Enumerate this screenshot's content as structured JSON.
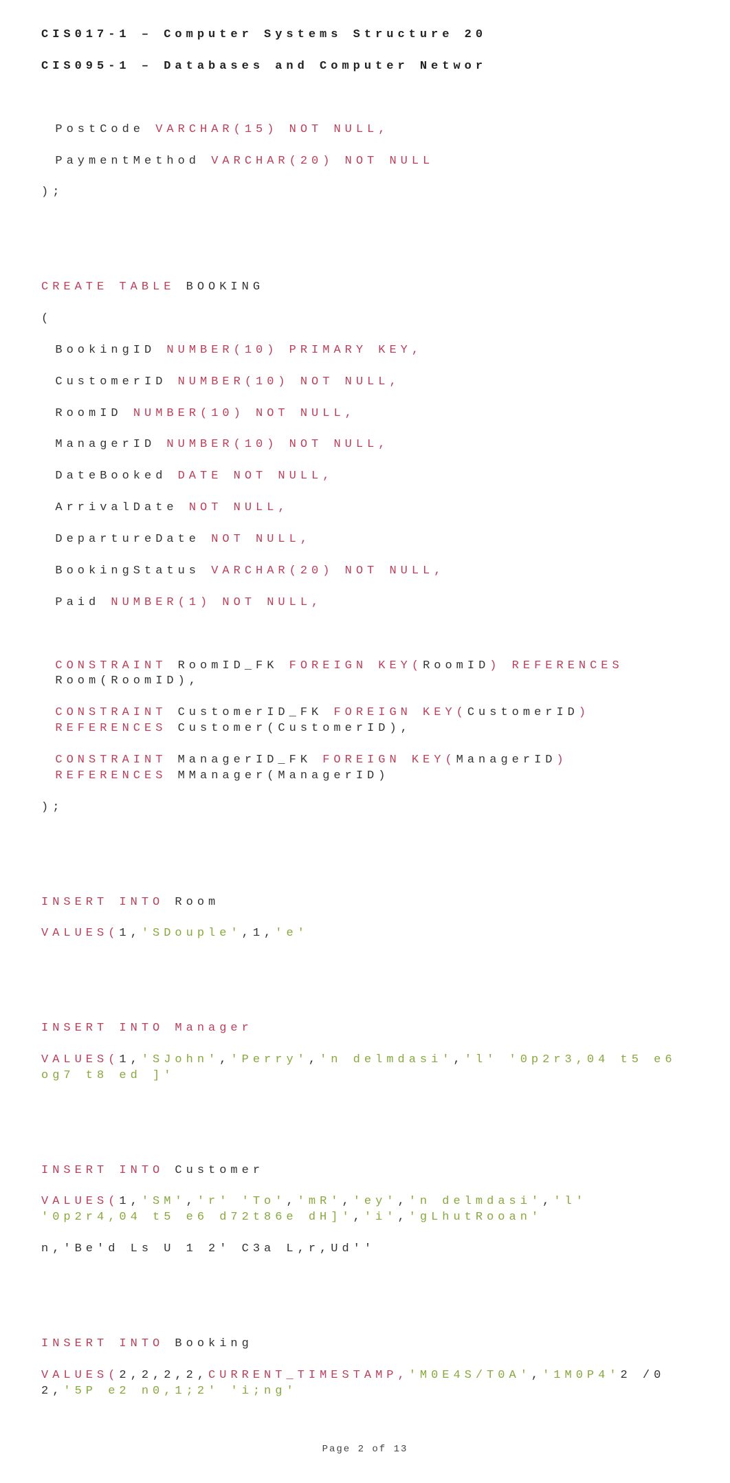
{
  "header": {
    "line1": "CIS017-1 – Computer Systems Structure 20",
    "line2": "CIS095-1 – Databases and Computer Networ"
  },
  "block1": {
    "l1_a": "PostCode ",
    "l1_b": "VARCHAR(15) NOT NULL,",
    "l2_a": "PaymentMethod ",
    "l2_b": "VARCHAR(20) NOT NULL",
    "l3": ");"
  },
  "create_booking": {
    "create": "CREATE TABLE ",
    "name": "BOOKING",
    "open": "(",
    "r1_id": "BookingID ",
    "r1_kw": "NUMBER(10) PRIMARY KEY,",
    "r2_id": "CustomerID ",
    "r2_kw": "NUMBER(10) NOT NULL,",
    "r3_id": "RoomID ",
    "r3_kw": "NUMBER(10) NOT NULL,",
    "r4_id": "ManagerID ",
    "r4_kw": "NUMBER(10) NOT NULL,",
    "r5_id": "DateBooked ",
    "r5_kw": "DATE NOT NULL,",
    "r6_id": "ArrivalDate ",
    "r6_kw": "NOT NULL,",
    "r7_id": "DepartureDate ",
    "r7_kw": "NOT NULL,",
    "r8_id": "BookingStatus ",
    "r8_kw": "VARCHAR(20) NOT NULL,",
    "r9_id": "Paid ",
    "r9_kw": "NUMBER(1) NOT NULL,",
    "c1_a": "CONSTRAINT ",
    "c1_b": "RoomID_FK ",
    "c1_c": "FOREIGN KEY(",
    "c1_d": "RoomID",
    "c1_e": ") REFERENCES ",
    "c1_f": "Room(RoomID),",
    "c2_a": "CONSTRAINT ",
    "c2_b": "CustomerID_FK ",
    "c2_c": "FOREIGN KEY(",
    "c2_d": "CustomerID",
    "c2_e": ") REFERENCES ",
    "c2_f": "Customer(CustomerID),",
    "c3_a": "CONSTRAINT ",
    "c3_b": "ManagerID_FK ",
    "c3_c": "FOREIGN KEY(",
    "c3_d": "ManagerID",
    "c3_e": ") REFERENCES ",
    "c3_f": "MManager(ManagerID)",
    "close": ");"
  },
  "ins_room": {
    "ins": "INSERT INTO ",
    "tbl": "Room",
    "vals": "VALUES(",
    "v_num1": "1,",
    "v_str1": "'SDouple'",
    "v_sep": ",",
    "v_num2": "1,",
    "v_str2": "'e'"
  },
  "ins_manager": {
    "ins": "INSERT INTO Manager",
    "vals": "VALUES(",
    "v1": "1,",
    "s1": "'SJohn'",
    "s2": "'Perry'",
    "s3": "'n delmdasi'",
    "s4": "'l'",
    "s5": "'0p2r3,04 t5 e6 og7 t8 ed ]'"
  },
  "ins_customer": {
    "ins": "INSERT INTO ",
    "tbl": "Customer",
    "vals": "VALUES(",
    "v1": "1,",
    "s1": "'SM'",
    "s2": "'r'",
    "s3": "'To'",
    "s4": "'mR'",
    "s5": "'ey'",
    "s6": "'n delmdasi'",
    "s7": "'l'",
    "s8": "'0p2r4,04 t5 e6 d72t86e dH]'",
    "s9": "'i'",
    "s10": "'gLhutRooan'",
    "cont": "n,'Be'd Ls U 1 2' C3a L,r,Ud''"
  },
  "ins_booking": {
    "ins": "INSERT INTO ",
    "tbl": "Booking",
    "vals": "VALUES(",
    "nums": "2,2,2,2,",
    "ct": "CURRENT_TIMESTAMP,",
    "s1": "'M0E4S/T0A'",
    "s2": "'1M0P4'",
    "n2": "2 /0 2,",
    "s3": "'5P e2 n0,1;2'",
    "s4": "'i;ng'"
  },
  "page": "Page 2 of 13"
}
